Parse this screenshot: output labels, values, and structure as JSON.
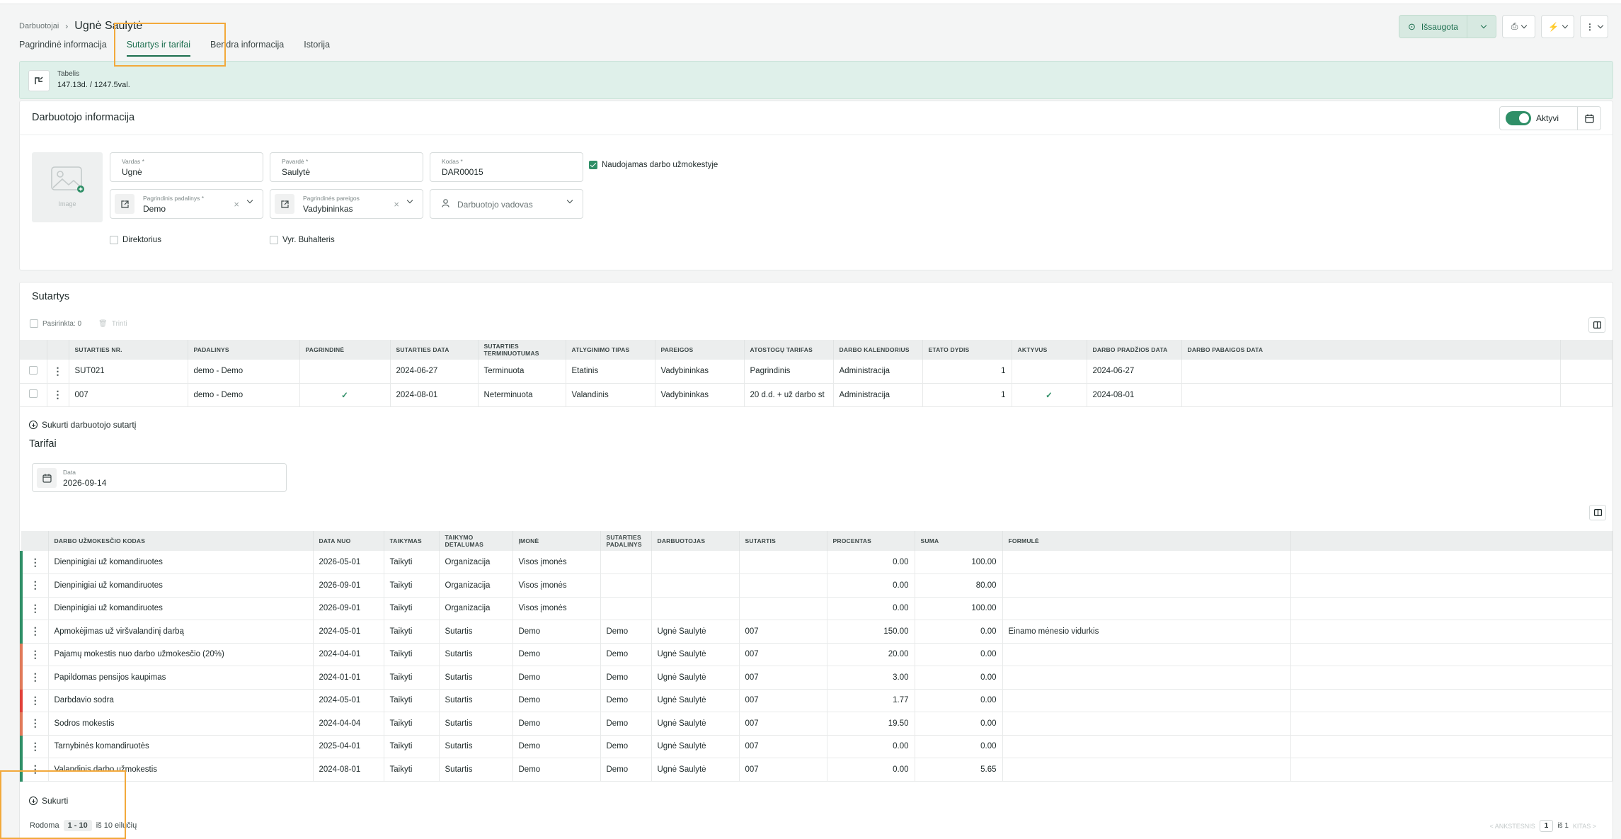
{
  "breadcrumb": {
    "parent": "Darbuotojai",
    "current": "Ugnė Saulytė"
  },
  "tabs": [
    "Pagrindinė informacija",
    "Sutartys ir tarifai",
    "Bendra informacija",
    "Istorija"
  ],
  "header_actions": {
    "save_label": "Išsaugota"
  },
  "tabelis": {
    "label": "Tabelis",
    "value": "147.13d. / 1247.5val."
  },
  "employee": {
    "title": "Darbuotojo informacija",
    "active_label": "Aktyvi",
    "image_label": "Image",
    "first_name": {
      "label": "Vardas *",
      "value": "Ugnė"
    },
    "last_name": {
      "label": "Pavardė *",
      "value": "Saulytė"
    },
    "code": {
      "label": "Kodas *",
      "value": "DAR00015"
    },
    "payroll_label": "Naudojamas darbo užmokestyje",
    "department": {
      "label": "Pagrindinis padalinys *",
      "value": "Demo"
    },
    "position": {
      "label": "Pagrindinės pareigos",
      "value": "Vadybininkas"
    },
    "manager_placeholder": "Darbuotojo vadovas",
    "director_label": "Direktorius",
    "accountant_label": "Vyr. Buhalteris"
  },
  "contracts": {
    "title": "Sutartys",
    "selected": "Pasirinkta: 0",
    "delete": "Trinti",
    "columns": [
      "SUTARTIES NR.",
      "PADALINYS",
      "PAGRINDINĖ",
      "SUTARTIES DATA",
      "SUTARTIES TERMINUOTUMAS",
      "ATLYGINIMO TIPAS",
      "PAREIGOS",
      "ATOSTOGŲ TARIFAS",
      "DARBO KALENDORIUS",
      "ETATO DYDIS",
      "AKTYVUS",
      "DARBO PRADŽIOS DATA",
      "DARBO PABAIGOS DATA"
    ],
    "rows": [
      [
        "SUT021",
        "demo - Demo",
        "",
        "2024-06-27",
        "Terminuota",
        "Etatinis",
        "Vadybininkas",
        "Pagrindinis",
        "Administracija",
        "1",
        "",
        "2024-06-27",
        ""
      ],
      [
        "007",
        "demo - Demo",
        "✓",
        "2024-08-01",
        "Neterminuota",
        "Valandinis",
        "Vadybininkas",
        "20 d.d. + už darbo st",
        "Administracija",
        "1",
        "✓",
        "2024-08-01",
        ""
      ]
    ],
    "create_label": "Sukurti darbuotojo sutartį"
  },
  "tariffs": {
    "title": "Tarifai",
    "date_label": "Data",
    "date_value": "2026-09-14",
    "columns": [
      "DARBO UŽMOKESČIO KODAS",
      "DATA NUO",
      "TAIKYMAS",
      "TAIKYMO DETALUMAS",
      "ĮMONĖ",
      "SUTARTIES PADALINYS",
      "DARBUOTOJAS",
      "SUTARTIS",
      "PROCENTAS",
      "SUMA",
      "FORMULĖ"
    ],
    "rows": [
      {
        "color": "#2f8f67",
        "cells": [
          "Dienpinigiai už komandiruotes",
          "2026-05-01",
          "Taikyti",
          "Organizacija",
          "Visos įmonės",
          "",
          "",
          "",
          "0.00",
          "100.00",
          ""
        ]
      },
      {
        "color": "#2f8f67",
        "cells": [
          "Dienpinigiai už komandiruotes",
          "2026-09-01",
          "Taikyti",
          "Organizacija",
          "Visos įmonės",
          "",
          "",
          "",
          "0.00",
          "80.00",
          ""
        ]
      },
      {
        "color": "#2f8f67",
        "cells": [
          "Dienpinigiai už komandiruotes",
          "2026-09-01",
          "Taikyti",
          "Organizacija",
          "Visos įmonės",
          "",
          "",
          "",
          "0.00",
          "100.00",
          ""
        ]
      },
      {
        "color": "#2f8f67",
        "cells": [
          "Apmokėjimas už viršvalandinį darbą",
          "2024-05-01",
          "Taikyti",
          "Sutartis",
          "Demo",
          "Demo",
          "Ugnė Saulytė",
          "007",
          "150.00",
          "0.00",
          "Einamo mėnesio vidurkis"
        ]
      },
      {
        "color": "#e07a5a",
        "cells": [
          "Pajamų mokestis nuo darbo užmokesčio (20%)",
          "2024-04-01",
          "Taikyti",
          "Sutartis",
          "Demo",
          "Demo",
          "Ugnė Saulytė",
          "007",
          "20.00",
          "0.00",
          ""
        ]
      },
      {
        "color": "#e07a5a",
        "cells": [
          "Papildomas pensijos kaupimas",
          "2024-01-01",
          "Taikyti",
          "Sutartis",
          "Demo",
          "Demo",
          "Ugnė Saulytė",
          "007",
          "3.00",
          "0.00",
          ""
        ]
      },
      {
        "color": "#e0413a",
        "cells": [
          "Darbdavio sodra",
          "2024-05-01",
          "Taikyti",
          "Sutartis",
          "Demo",
          "Demo",
          "Ugnė Saulytė",
          "007",
          "1.77",
          "0.00",
          ""
        ]
      },
      {
        "color": "#e07a5a",
        "cells": [
          "Sodros mokestis",
          "2024-04-04",
          "Taikyti",
          "Sutartis",
          "Demo",
          "Demo",
          "Ugnė Saulytė",
          "007",
          "19.50",
          "0.00",
          ""
        ]
      },
      {
        "color": "#2f8f67",
        "cells": [
          "Tarnybinės komandiruotės",
          "2025-04-01",
          "Taikyti",
          "Sutartis",
          "Demo",
          "Demo",
          "Ugnė Saulytė",
          "007",
          "0.00",
          "0.00",
          ""
        ]
      },
      {
        "color": "#2f8f67",
        "cells": [
          "Valandinis darbo užmokestis",
          "2024-08-01",
          "Taikyti",
          "Sutartis",
          "Demo",
          "Demo",
          "Ugnė Saulytė",
          "007",
          "0.00",
          "5.65",
          ""
        ]
      }
    ],
    "create_label": "Sukurti"
  },
  "pagination": {
    "showing": "Rodoma",
    "range": "1 - 10",
    "of": "iš 10 eilučių",
    "prev": "< ANKSTESNIS",
    "page": "1",
    "pages": "iš 1",
    "next": "KITAS >"
  }
}
